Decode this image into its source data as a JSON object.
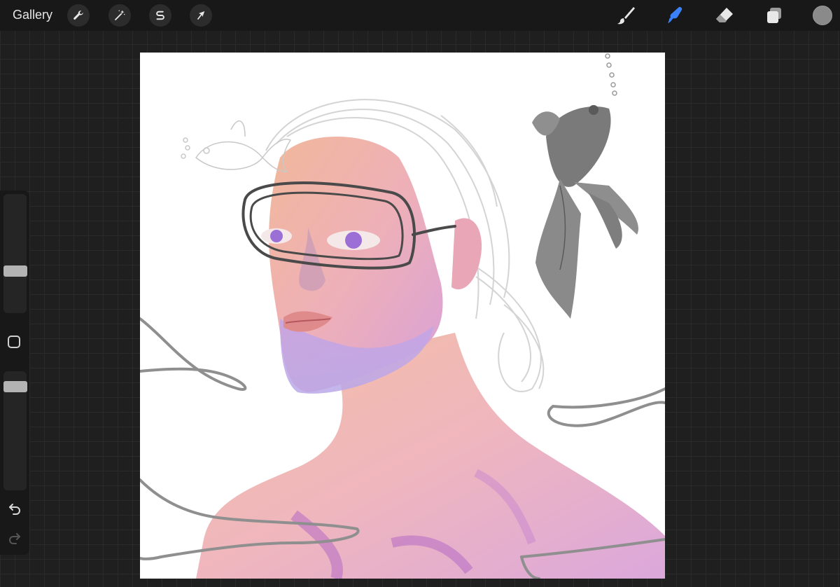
{
  "topbar": {
    "gallery_label": "Gallery",
    "left_tools": [
      "wrench-icon",
      "magic-wand-icon",
      "selection-s-icon",
      "transform-arrow-icon"
    ],
    "right_tools": [
      "brush-icon",
      "smudge-icon",
      "eraser-icon",
      "layers-icon"
    ],
    "active_tool": "smudge-icon",
    "accent_color": "#3b82f6",
    "current_color": "#8a8a8a"
  },
  "sidebar": {
    "brush_size": 0.42,
    "opacity": 0.85,
    "buttons": [
      "modify-square-icon",
      "undo-icon",
      "redo-icon"
    ]
  },
  "canvas": {
    "background": "#ffffff"
  }
}
